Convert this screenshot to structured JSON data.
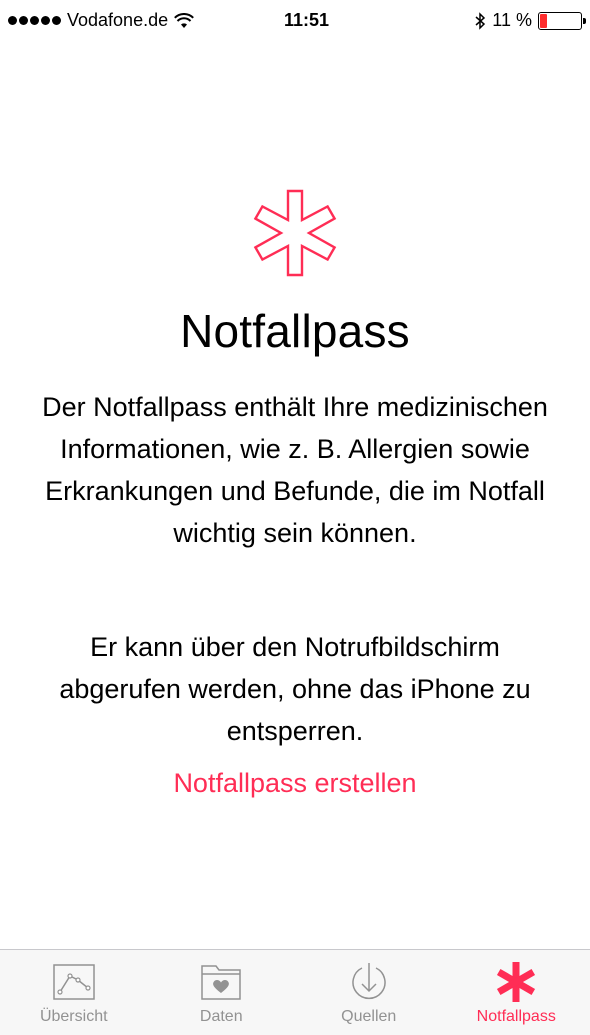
{
  "status_bar": {
    "carrier": "Vodafone.de",
    "time": "11:51",
    "battery": "11 %",
    "battery_level": 0.11
  },
  "main": {
    "title": "Notfallpass",
    "description": "Der Notfallpass enthält Ihre medizinischen Informationen, wie z. B. Allergien sowie Erkrankungen und Befunde, die im Notfall wichtig sein können.",
    "description2": "Er kann über den Notrufbildschirm abgerufen werden, ohne das iPhone zu entsperren.",
    "create_link": "Notfallpass erstellen"
  },
  "tabbar": {
    "items": [
      {
        "label": "Übersicht",
        "icon": "chart-icon"
      },
      {
        "label": "Daten",
        "icon": "folder-heart-icon"
      },
      {
        "label": "Quellen",
        "icon": "download-circle-icon"
      },
      {
        "label": "Notfallpass",
        "icon": "asterisk-icon",
        "active": true
      }
    ]
  },
  "colors": {
    "accent": "#ff2d55",
    "battery_low": "#ff2d2d",
    "tab_inactive": "#929292"
  }
}
